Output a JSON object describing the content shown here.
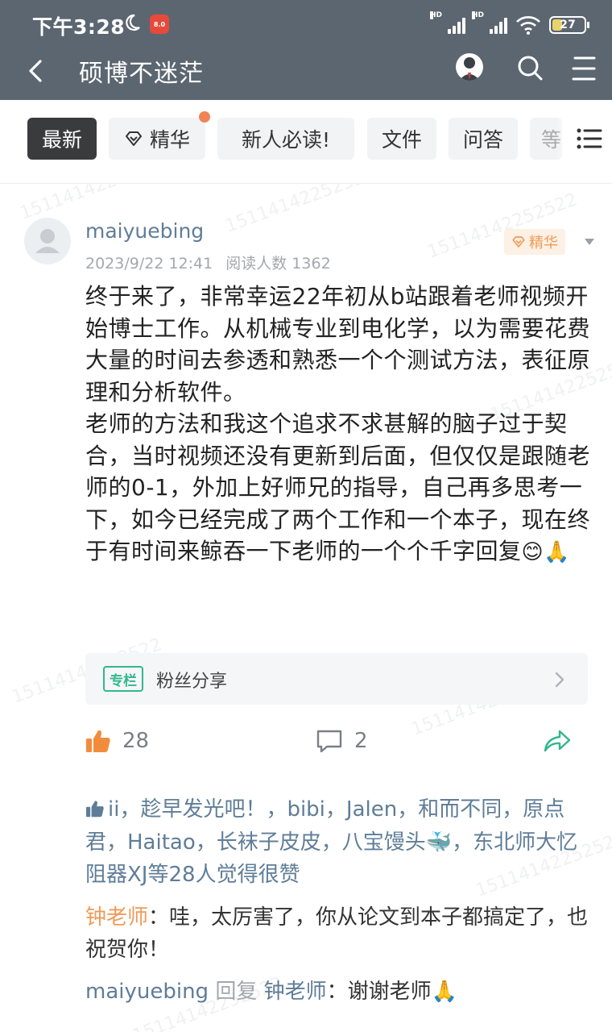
{
  "status_bar": {
    "time": "下午3:28",
    "app_badge": "8.0",
    "network1": "HD",
    "network2": "HD",
    "battery": "27"
  },
  "nav": {
    "title": "硕博不迷茫"
  },
  "tabs": [
    {
      "label": "最新",
      "active": true
    },
    {
      "label": "精华",
      "active": false
    },
    {
      "label": "新人必读!",
      "active": false
    },
    {
      "label": "文件",
      "active": false
    },
    {
      "label": "问答",
      "active": false
    },
    {
      "label": "等",
      "active": false
    }
  ],
  "post": {
    "author": "maiyuebing",
    "date": "2023/9/22 12:41",
    "reads_label": "阅读人数 1362",
    "badge": "精华",
    "paragraph1": "终于来了，非常幸运22年初从b站跟着老师视频开始博士工作。从机械专业到电化学，以为需要花费大量的时间去参透和熟悉一个个测试方法，表征原理和分析软件。",
    "paragraph2": "老师的方法和我这个追求不求甚解的脑子过于契合，当时视频还没有更新到后面，但仅仅是跟随老师的0-1，外加上好师兄的指导，自己再多思考一下，如今已经完成了两个工作和一个本子，现在终于有时间来鲸吞一下老师的一个个千字回复",
    "emoji": "😊🙏",
    "column_tag": "专栏",
    "column_title": "粉丝分享",
    "like_count": "28",
    "comment_count": "2"
  },
  "likers": {
    "text_before": "ii，趁早发光吧！，bibi，Jalen，和而不同，原点君，Haitao，长袜子皮皮，八宝馒头",
    "emoji": "🐳",
    "text_after": "，东北师大忆阻器XJ等28人觉得很赞"
  },
  "comments": [
    {
      "name": "钟老师",
      "sep": "：",
      "text": "哇，太厉害了，你从论文到本子都搞定了，也祝贺你！"
    },
    {
      "name": "maiyuebing",
      "reply_word": " 回复 ",
      "reply_to": "钟老师",
      "sep": "：",
      "text": "谢谢老师",
      "emoji": "🙏"
    }
  ],
  "watermark": "15114142252522",
  "colors": {
    "header_bg": "#5c6671",
    "accent_orange": "#ef9b59",
    "link_blue": "#5f7d98",
    "column_green": "#32b78a"
  }
}
